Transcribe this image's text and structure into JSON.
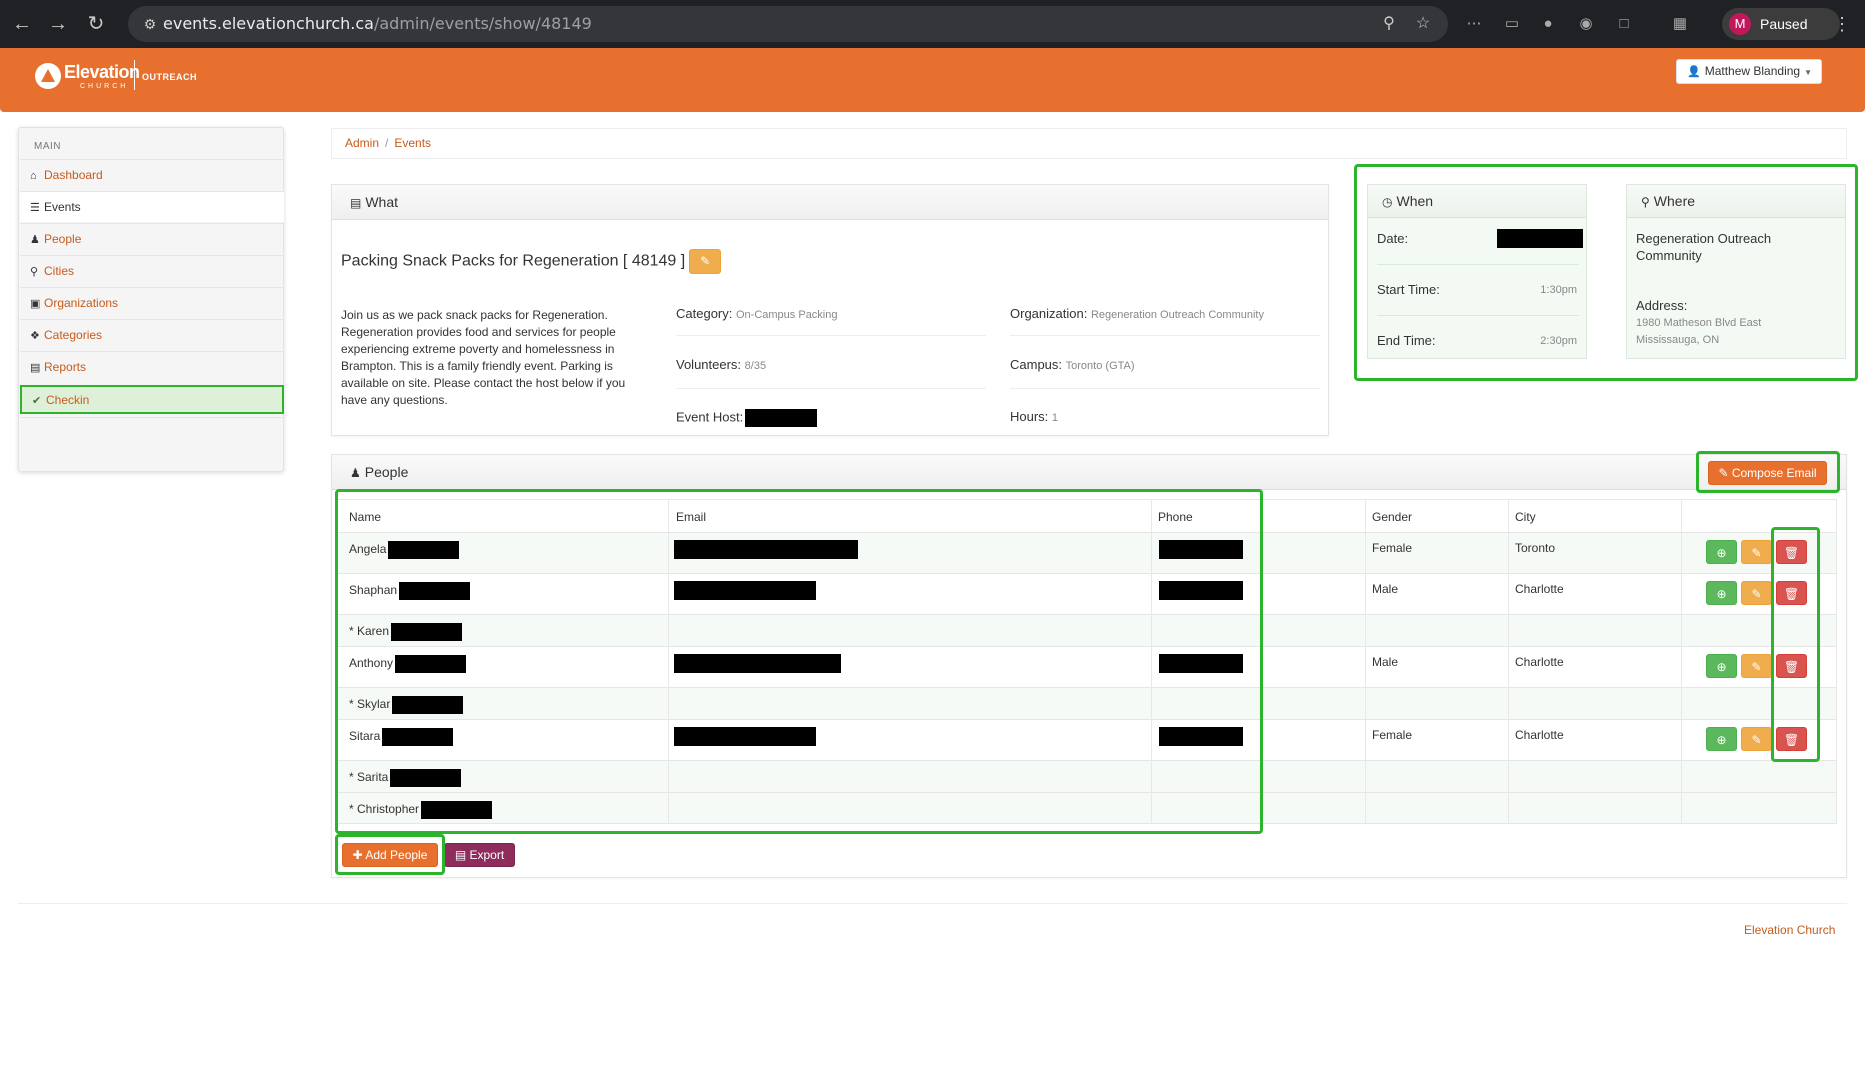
{
  "browser": {
    "url_host": "events.elevationchurch.ca",
    "url_path": "/admin/events/show/48149",
    "profile_initial": "M",
    "profile_label": "Paused"
  },
  "header": {
    "logo_word": "Elevation",
    "logo_church": "CHURCH",
    "logo_section": "OUTREACH",
    "user_name": "Matthew Blanding",
    "brand_color": "#e8702e"
  },
  "sidebar": {
    "heading": "MAIN",
    "items": [
      {
        "label": "Dashboard",
        "icon": "home-icon"
      },
      {
        "label": "Events",
        "icon": "list-icon"
      },
      {
        "label": "People",
        "icon": "user-icon"
      },
      {
        "label": "Cities",
        "icon": "map-marker-icon"
      },
      {
        "label": "Organizations",
        "icon": "briefcase-icon"
      },
      {
        "label": "Categories",
        "icon": "tags-icon"
      },
      {
        "label": "Reports",
        "icon": "file-icon"
      },
      {
        "label": "Checkin",
        "icon": "check-icon"
      }
    ]
  },
  "breadcrumb": {
    "items": [
      "Admin",
      "Events"
    ]
  },
  "what": {
    "title": "What",
    "event_title": "Packing Snack Packs for Regeneration [ 48149 ]",
    "description": "Join us as we pack snack packs for Regeneration. Regeneration provides food and services for people experiencing extreme poverty and homelessness in Brampton. This is a family friendly event. Parking is available on site. Please contact the host below if you have any questions.",
    "category_label": "Category:",
    "category_value": "On-Campus Packing",
    "volunteers_label": "Volunteers:",
    "volunteers_value": "8/35",
    "host_label": "Event Host:",
    "organization_label": "Organization:",
    "organization_value": "Regeneration Outreach Community",
    "campus_label": "Campus:",
    "campus_value": "Toronto (GTA)",
    "hours_label": "Hours:",
    "hours_value": "1"
  },
  "when": {
    "title": "When",
    "date_label": "Date:",
    "start_label": "Start Time:",
    "start_value": "1:30pm",
    "end_label": "End Time:",
    "end_value": "2:30pm"
  },
  "where": {
    "title": "Where",
    "name": "Regeneration Outreach Community",
    "address_label": "Address:",
    "address_line1": "1980 Matheson Blvd East",
    "address_line2": "Mississauga, ON"
  },
  "people": {
    "title": "People",
    "compose_label": "Compose Email",
    "add_label": "Add People",
    "export_label": "Export",
    "columns": [
      "Name",
      "Email",
      "Phone",
      "Gender",
      "City"
    ],
    "rows": [
      {
        "name": "Angela",
        "gender": "Female",
        "city": "Toronto"
      },
      {
        "name": "Shaphan",
        "gender": "Male",
        "city": "Charlotte"
      },
      {
        "name": "* Karen",
        "gender": "",
        "city": ""
      },
      {
        "name": "Anthony",
        "gender": "Male",
        "city": "Charlotte"
      },
      {
        "name": "* Skylar",
        "gender": "",
        "city": ""
      },
      {
        "name": "Sitara",
        "gender": "Female",
        "city": "Charlotte"
      },
      {
        "name": "* Sarita",
        "gender": "",
        "city": ""
      },
      {
        "name": "* Christopher",
        "gender": "",
        "city": ""
      }
    ]
  },
  "footer": {
    "link": "Elevation Church"
  }
}
